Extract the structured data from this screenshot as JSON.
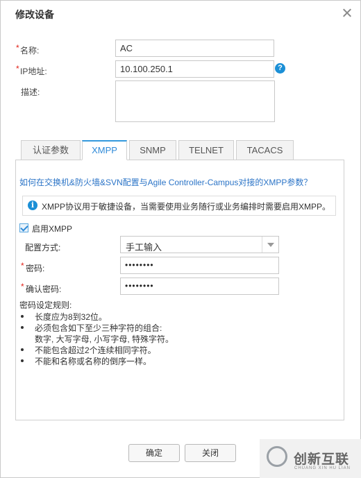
{
  "dialog": {
    "title": "修改设备"
  },
  "form": {
    "name": {
      "label": "名称:",
      "value": "AC"
    },
    "ip": {
      "label": "IP地址:",
      "value": "10.100.250.1"
    },
    "desc": {
      "label": "描述:",
      "value": ""
    }
  },
  "tabs": [
    {
      "label": "认证参数",
      "active": false
    },
    {
      "label": "XMPP",
      "active": true
    },
    {
      "label": "SNMP",
      "active": false
    },
    {
      "label": "TELNET",
      "active": false
    },
    {
      "label": "TACACS",
      "active": false
    }
  ],
  "xmpp": {
    "link": "如何在交换机&防火墙&SVN配置与Agile Controller-Campus对接的XMPP参数？",
    "info": "XMPP协议用于敏捷设备，当需要使用业务随行或业务编排时需要启用XMPP。",
    "enable_label": "启用XMPP",
    "enabled": true,
    "config_mode_label": "配置方式:",
    "config_mode_value": "手工输入",
    "password_label": "密码:",
    "password_value": "••••••••",
    "confirm_label": "确认密码:",
    "confirm_value": "••••••••",
    "rules_title": "密码设定规则:",
    "rules": [
      "长度应为8到32位。",
      "必须包含如下至少三种字符的组合:",
      "数字, 大写字母, 小写字母, 特殊字符。",
      "不能包含超过2个连续相同字符。",
      "不能和名称或名称的倒序一样。"
    ]
  },
  "buttons": {
    "ok": "确定",
    "close": "关闭"
  },
  "watermark": {
    "text": "创新互联",
    "sub": "CHUANG XIN HU LIAN"
  },
  "colors": {
    "accent": "#2e8ad8",
    "required": "#e2231a",
    "link": "#2b74c7"
  }
}
